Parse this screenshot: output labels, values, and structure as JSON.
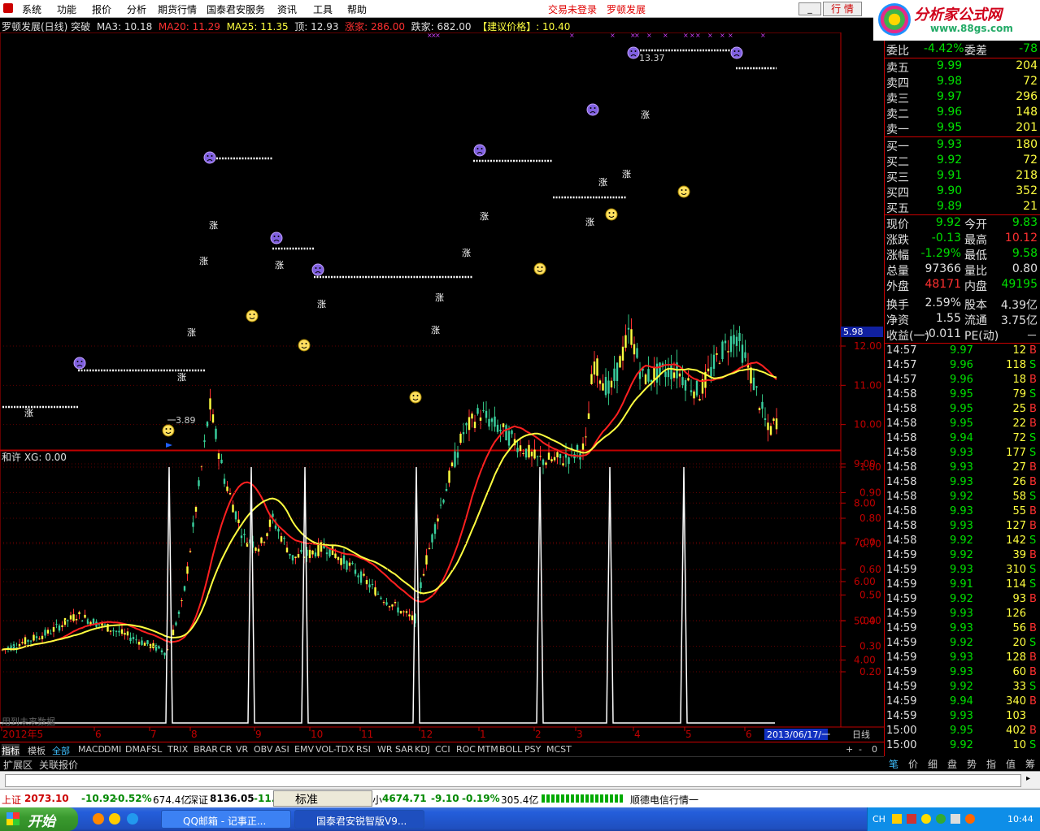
{
  "menu": {
    "items": [
      "系统",
      "功能",
      "报价",
      "分析",
      "期货行情",
      "国泰君安服务",
      "资讯",
      "工具",
      "帮助"
    ],
    "status_trade": "交易未登录",
    "stock_name": "罗顿发展",
    "hq_button": "行 情"
  },
  "logo": {
    "title": "分析家公式网",
    "url": "www.88gs.com",
    "behind": "600209 罗顿发展"
  },
  "chart_header": {
    "name": "罗顿发展(日线) 突破",
    "ma3": "MA3: 10.18",
    "ma20": "MA20: 11.29",
    "ma25": "MA25: 11.35",
    "top": "顶: 12.93",
    "up": "涨家: 286.00",
    "down": "跌家: 682.00",
    "advice": "【建议价格】: 10.40"
  },
  "price_axis": [
    "12.00",
    "11.00",
    "10.00",
    "9.00",
    "8.00",
    "7.00",
    "6.00",
    "5.00",
    "4.00"
  ],
  "price_marker": "5.98",
  "label_high": "13.37",
  "label_low": "3.89",
  "mark_up": "涨",
  "indicator": {
    "title": "和许 XG: 0.00",
    "axis": [
      "1.00",
      "0.90",
      "0.80",
      "0.70",
      "0.60",
      "0.50",
      "0.40",
      "0.30",
      "0.20"
    ],
    "future_note": "用到未来数据"
  },
  "date_axis": {
    "labels": [
      "2012年5",
      "6",
      "7",
      "8",
      "9",
      "10",
      "11",
      "12",
      "1",
      "2",
      "3",
      "4",
      "5",
      "6"
    ],
    "current": "2013/06/17/一",
    "period": "日线"
  },
  "tabs": [
    "指标",
    "模板",
    "全部",
    "MACD",
    "DMI",
    "DMA",
    "FSL",
    "TRIX",
    "BRAR",
    "CR",
    "VR",
    "OBV",
    "ASI",
    "EMV",
    "VOL-TDX",
    "RSI",
    "WR",
    "SAR",
    "KDJ",
    "CCI",
    "ROC",
    "MTM",
    "BOLL",
    "PSY",
    "MCST"
  ],
  "tab_ctrl": [
    "+",
    "-",
    "0"
  ],
  "ext": [
    "扩展区",
    "关联报价"
  ],
  "quote": {
    "ratio": {
      "label": "委比",
      "value": "-4.42%",
      "diff_label": "委差",
      "diff": "-78"
    },
    "asks": [
      {
        "label": "卖五",
        "price": "9.99",
        "vol": "204"
      },
      {
        "label": "卖四",
        "price": "9.98",
        "vol": "72"
      },
      {
        "label": "卖三",
        "price": "9.97",
        "vol": "296"
      },
      {
        "label": "卖二",
        "price": "9.96",
        "vol": "148"
      },
      {
        "label": "卖一",
        "price": "9.95",
        "vol": "201"
      }
    ],
    "bids": [
      {
        "label": "买一",
        "price": "9.93",
        "vol": "180"
      },
      {
        "label": "买二",
        "price": "9.92",
        "vol": "72"
      },
      {
        "label": "买三",
        "price": "9.91",
        "vol": "218"
      },
      {
        "label": "买四",
        "price": "9.90",
        "vol": "352"
      },
      {
        "label": "买五",
        "price": "9.89",
        "vol": "21"
      }
    ],
    "stats": [
      {
        "l1": "现价",
        "v1": "9.92",
        "c1": "#00e000",
        "l2": "今开",
        "v2": "9.83",
        "c2": "#00e000"
      },
      {
        "l1": "涨跌",
        "v1": "-0.13",
        "c1": "#00e000",
        "l2": "最高",
        "v2": "10.12",
        "c2": "#ff3030"
      },
      {
        "l1": "涨幅",
        "v1": "-1.29%",
        "c1": "#00e000",
        "l2": "最低",
        "v2": "9.58",
        "c2": "#00e000"
      },
      {
        "l1": "总量",
        "v1": "97366",
        "c1": "#e0e0e0",
        "l2": "量比",
        "v2": "0.80",
        "c2": "#e0e0e0"
      },
      {
        "l1": "外盘",
        "v1": "48171",
        "c1": "#ff3030",
        "l2": "内盘",
        "v2": "49195",
        "c2": "#00e000"
      },
      {
        "l1": "换手",
        "v1": "2.59%",
        "c1": "#e0e0e0",
        "l2": "股本",
        "v2": "4.39亿",
        "c2": "#e0e0e0"
      },
      {
        "l1": "净资",
        "v1": "1.55",
        "c1": "#e0e0e0",
        "l2": "流通",
        "v2": "3.75亿",
        "c2": "#e0e0e0"
      },
      {
        "l1": "收益(一)",
        "v1": "-0.011",
        "c1": "#e0e0e0",
        "l2": "PE(动)",
        "v2": "－",
        "c2": "#e0e0e0"
      }
    ],
    "ticks": [
      {
        "t": "14:57",
        "p": "9.97",
        "v": "12",
        "s": "B"
      },
      {
        "t": "14:57",
        "p": "9.96",
        "v": "118",
        "s": "S"
      },
      {
        "t": "14:57",
        "p": "9.96",
        "v": "18",
        "s": "B"
      },
      {
        "t": "14:58",
        "p": "9.95",
        "v": "79",
        "s": "S"
      },
      {
        "t": "14:58",
        "p": "9.95",
        "v": "25",
        "s": "B"
      },
      {
        "t": "14:58",
        "p": "9.95",
        "v": "22",
        "s": "B"
      },
      {
        "t": "14:58",
        "p": "9.94",
        "v": "72",
        "s": "S"
      },
      {
        "t": "14:58",
        "p": "9.93",
        "v": "177",
        "s": "S"
      },
      {
        "t": "14:58",
        "p": "9.93",
        "v": "27",
        "s": "B"
      },
      {
        "t": "14:58",
        "p": "9.93",
        "v": "26",
        "s": "B"
      },
      {
        "t": "14:58",
        "p": "9.92",
        "v": "58",
        "s": "S"
      },
      {
        "t": "14:58",
        "p": "9.93",
        "v": "55",
        "s": "B"
      },
      {
        "t": "14:58",
        "p": "9.93",
        "v": "127",
        "s": "B"
      },
      {
        "t": "14:58",
        "p": "9.92",
        "v": "142",
        "s": "S"
      },
      {
        "t": "14:59",
        "p": "9.92",
        "v": "39",
        "s": "B"
      },
      {
        "t": "14:59",
        "p": "9.93",
        "v": "310",
        "s": "S"
      },
      {
        "t": "14:59",
        "p": "9.91",
        "v": "114",
        "s": "S"
      },
      {
        "t": "14:59",
        "p": "9.92",
        "v": "93",
        "s": "B"
      },
      {
        "t": "14:59",
        "p": "9.93",
        "v": "126",
        "s": ""
      },
      {
        "t": "14:59",
        "p": "9.93",
        "v": "56",
        "s": "B"
      },
      {
        "t": "14:59",
        "p": "9.92",
        "v": "20",
        "s": "S"
      },
      {
        "t": "14:59",
        "p": "9.93",
        "v": "128",
        "s": "B"
      },
      {
        "t": "14:59",
        "p": "9.93",
        "v": "60",
        "s": "B"
      },
      {
        "t": "14:59",
        "p": "9.92",
        "v": "33",
        "s": "S"
      },
      {
        "t": "14:59",
        "p": "9.94",
        "v": "340",
        "s": "B"
      },
      {
        "t": "14:59",
        "p": "9.93",
        "v": "103",
        "s": ""
      },
      {
        "t": "15:00",
        "p": "9.95",
        "v": "402",
        "s": "B"
      },
      {
        "t": "15:00",
        "p": "9.92",
        "v": "10",
        "s": "S"
      }
    ],
    "tabs": [
      "笔",
      "价",
      "细",
      "盘",
      "势",
      "指",
      "值",
      "筹"
    ]
  },
  "status": {
    "sh_label": "上证",
    "sh": "2073.10",
    "sh_chg": "-10.92",
    "sh_pct": "-0.52%",
    "sh_amt": "674.4亿",
    "sz_label": "深证",
    "sz": "8136.05",
    "sz_chg": "-11.",
    "ime": "标准",
    "mid_label": "小",
    "mid": "4674.71",
    "mid_chg": "-9.10",
    "mid_pct": "-0.19%",
    "mid_amt": "305.4亿",
    "broker": "顺德电信行情一"
  },
  "taskbar": {
    "start": "开始",
    "tasks": [
      "QQ邮箱 - 记事正...",
      "国泰君安锐智版V9..."
    ],
    "lang": "CH",
    "clock": "10:44"
  },
  "colors": {
    "up": "#ff3030",
    "down": "#00e000",
    "ma_red": "#ff2020",
    "ma_yellow": "#ffff40",
    "axis_red": "#c00000"
  }
}
